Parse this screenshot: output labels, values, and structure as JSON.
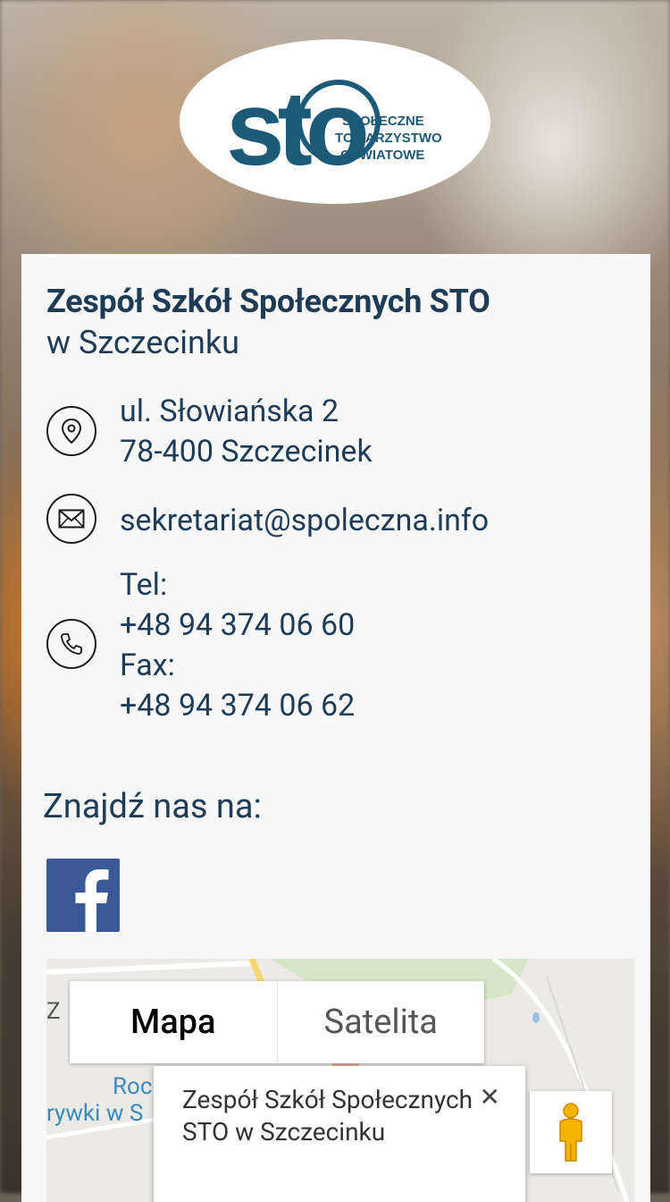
{
  "logo": {
    "mark": "sto",
    "line1": "SPOŁECZNE",
    "line2": "TOWARZYSTWO",
    "line3": "OŚWIATOWE",
    "color": "#1d5a78"
  },
  "school": {
    "name": "Zespół Szkół Społecznych STO",
    "location": "w Szczecinku"
  },
  "address": {
    "icon": "location-pin-icon",
    "line1": "ul. Słowiańska 2",
    "line2": "78-400 Szczecinek"
  },
  "email": {
    "icon": "envelope-icon",
    "value": "sekretariat@spoleczna.info"
  },
  "phone": {
    "icon": "phone-icon",
    "tel_label": "Tel:",
    "tel": "+48 94 374 06 60",
    "fax_label": "Fax:",
    "fax": "+48 94 374 06 62"
  },
  "social": {
    "heading": "Znajdź nas na:",
    "facebook_icon": "facebook-icon",
    "facebook_color": "#3b5998"
  },
  "map": {
    "tab_map": "Mapa",
    "tab_satellite": "Satelita",
    "infowindow_title": "Zespół Szkół Społecznych STO w Szczecinku",
    "close_icon": "close-icon",
    "pegman_icon": "street-view-pegman-icon",
    "label_fragment_1": "Roc",
    "label_fragment_2": "rywki w S",
    "label_fragment_3": "Z"
  },
  "colors": {
    "heading": "#1f3c57",
    "card_bg": "#f8f8f9"
  }
}
